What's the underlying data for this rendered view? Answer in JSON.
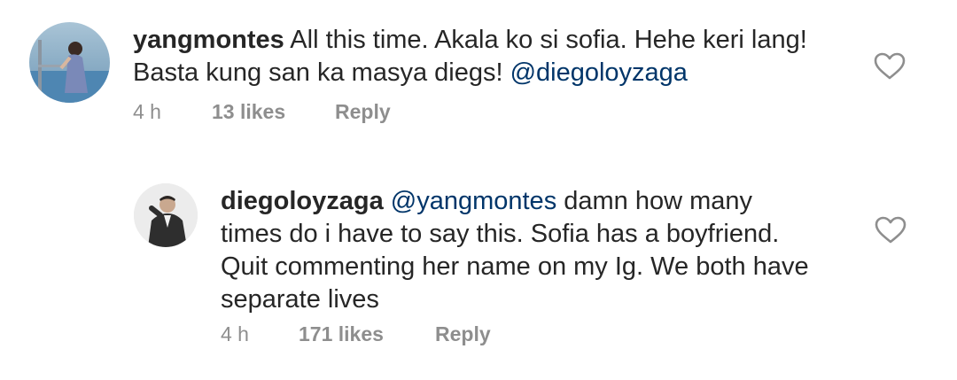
{
  "comments": [
    {
      "username": "yangmontes",
      "line1": "All this time. Akala ko si sofia. Hehe keri lang!",
      "line2_prefix": "Basta kung san ka masya diegs! ",
      "mention": "@diegoloyzaga",
      "time": "4 h",
      "likes": "13 likes",
      "reply": "Reply"
    },
    {
      "username": "diegoloyzaga",
      "mention": "@yangmontes",
      "line1_suffix": " damn how many",
      "line2": "times do i have to say this. Sofia has a boyfriend.",
      "line3": "Quit commenting her name on my Ig. We both have",
      "line4": "separate lives",
      "time": "4 h",
      "likes": "171 likes",
      "reply": "Reply"
    }
  ],
  "colors": {
    "text": "#262626",
    "mention": "#003569",
    "meta": "#8e8e8e"
  },
  "icons": {
    "like": "heart-outline-icon"
  }
}
